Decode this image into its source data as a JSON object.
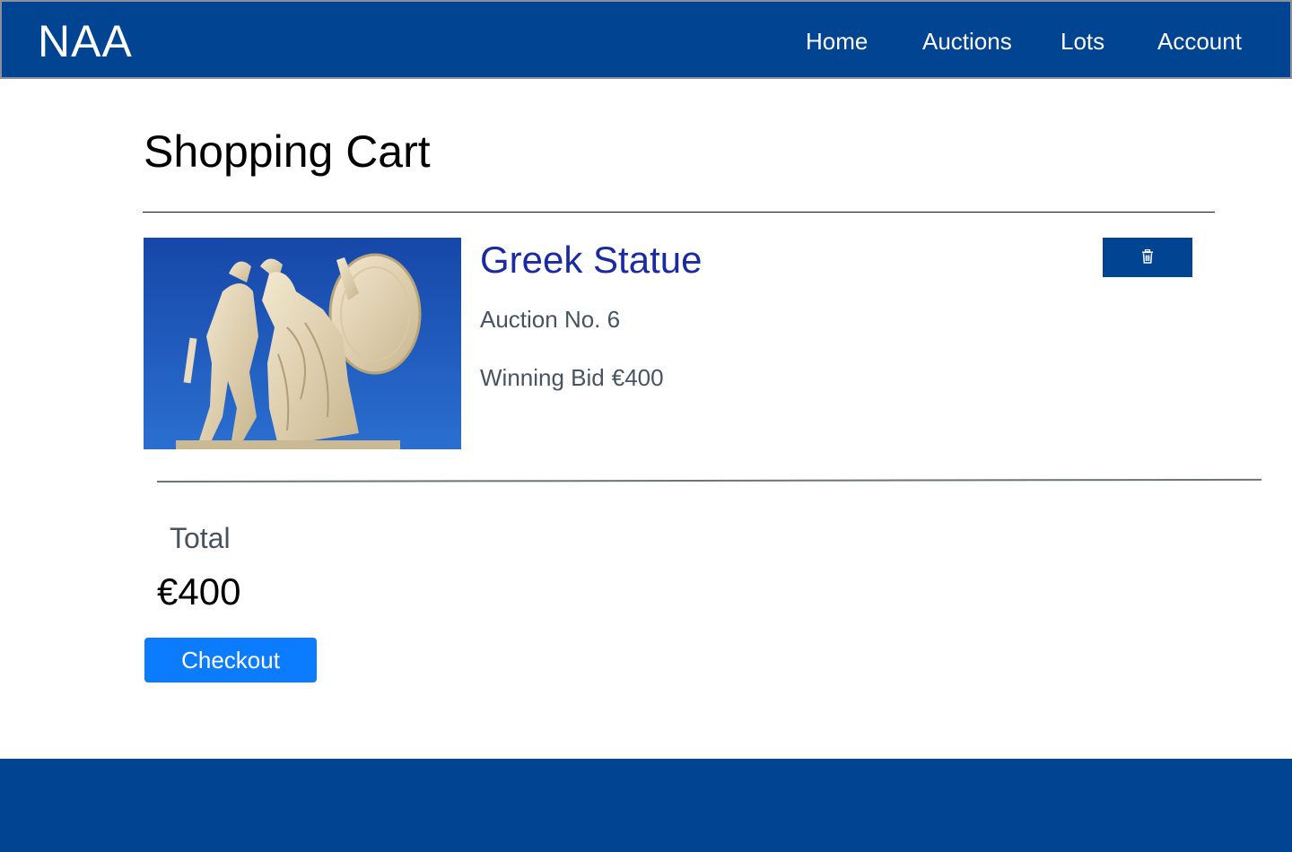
{
  "header": {
    "brand": "NAA",
    "nav": [
      {
        "label": "Home"
      },
      {
        "label": "Auctions"
      },
      {
        "label": "Lots"
      },
      {
        "label": "Account"
      }
    ]
  },
  "main": {
    "title": "Shopping Cart",
    "cart_items": [
      {
        "title": "Greek Statue",
        "auction": "Auction No. 6",
        "bid_label": "Winning Bid",
        "bid_value": "€400",
        "image_icon": "statue-image",
        "delete_icon": "trash-icon"
      }
    ],
    "total_label": "Total",
    "total_value": "€400",
    "checkout_label": "Checkout"
  },
  "colors": {
    "primary": "#004492",
    "accent": "#0b7cfe",
    "title_link": "#1a2ba0",
    "muted_text": "#485362"
  }
}
